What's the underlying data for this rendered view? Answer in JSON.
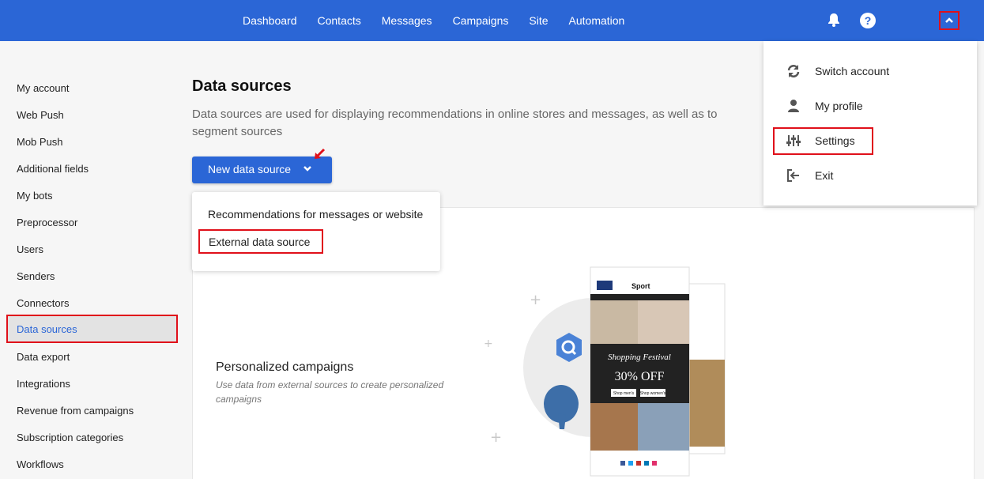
{
  "topnav": {
    "items": [
      "Dashboard",
      "Contacts",
      "Messages",
      "Campaigns",
      "Site",
      "Automation"
    ],
    "icons": [
      "bell-icon",
      "help-icon",
      "chevron-up-icon"
    ]
  },
  "sidebar": {
    "items": [
      "My account",
      "Web Push",
      "Mob Push",
      "Additional fields",
      "My bots",
      "Preprocessor",
      "Users",
      "Senders",
      "Connectors",
      "Data sources",
      "Data export",
      "Integrations",
      "Revenue from campaigns",
      "Subscription categories",
      "Workflows"
    ],
    "active": "Data sources"
  },
  "main": {
    "title": "Data sources",
    "description": "Data sources are used for displaying recommendations in online stores and messages, as well as to segment sources",
    "new_button": "New data source",
    "dropdown": [
      "Recommendations for messages or website",
      "External data source"
    ]
  },
  "card": {
    "title": "Personalized campaigns",
    "description": "Use data from external sources to create personalized campaigns"
  },
  "account_menu": {
    "items": [
      {
        "label": "Switch account",
        "icon": "sync-icon"
      },
      {
        "label": "My profile",
        "icon": "user-icon"
      },
      {
        "label": "Settings",
        "icon": "sliders-icon"
      },
      {
        "label": "Exit",
        "icon": "exit-icon"
      }
    ]
  },
  "illustration": {
    "brand": "Sport",
    "headline": "Shopping Festival",
    "offer": "30% OFF",
    "cta1": "Shop men's",
    "cta2": "Shop women's"
  },
  "colors": {
    "primary": "#2b66d6",
    "highlight": "#e0101a"
  }
}
